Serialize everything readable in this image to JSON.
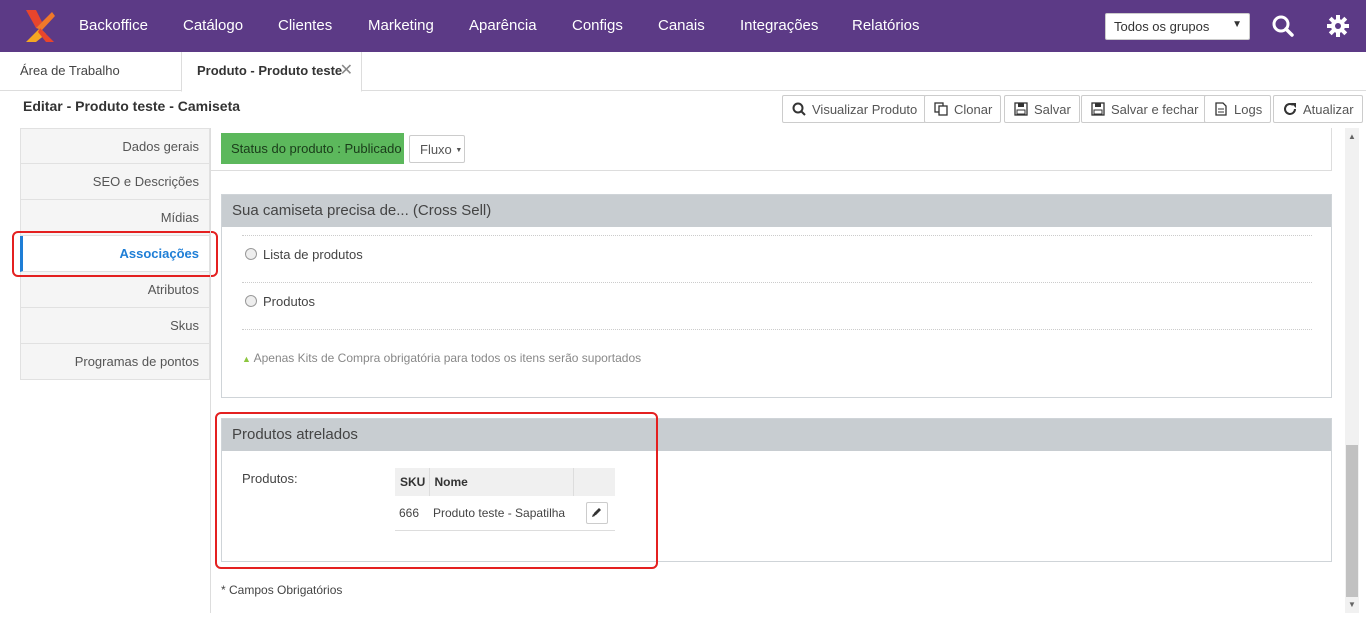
{
  "nav": {
    "items": [
      "Backoffice",
      "Catálogo",
      "Clientes",
      "Marketing",
      "Aparência",
      "Configs",
      "Canais",
      "Integrações",
      "Relatórios"
    ],
    "group_select": "Todos os grupos"
  },
  "tabs": {
    "home": "Área de Trabalho",
    "active": "Produto - Produto teste"
  },
  "header": {
    "title": "Editar - Produto teste - Camiseta",
    "buttons": {
      "view": "Visualizar Produto",
      "clone": "Clonar",
      "save": "Salvar",
      "save_close": "Salvar e fechar",
      "logs": "Logs",
      "refresh": "Atualizar"
    }
  },
  "sidebar": {
    "items": [
      "Dados gerais",
      "SEO e Descrições",
      "Mídias",
      "Associações",
      "Atributos",
      "Skus",
      "Programas de pontos"
    ]
  },
  "status": {
    "badge": "Status do produto : Publicado",
    "fluxo": "Fluxo"
  },
  "cross_sell": {
    "title": "Sua camiseta precisa de... (Cross Sell)",
    "option1": "Lista de produtos",
    "option2": "Produtos",
    "note": "Apenas Kits de Compra obrigatória para todos os itens serão suportados"
  },
  "linked": {
    "title": "Produtos atrelados",
    "label": "Produtos:",
    "columns": [
      "SKU",
      "Nome"
    ],
    "rows": [
      {
        "sku": "666",
        "name": "Produto teste - Sapatilha"
      }
    ]
  },
  "footnote": "* Campos Obrigatórios",
  "colors": {
    "topbar": "#5c3a86",
    "accent": "#1e7ed6",
    "status": "#5cb85c",
    "highlight": "#e42020"
  }
}
